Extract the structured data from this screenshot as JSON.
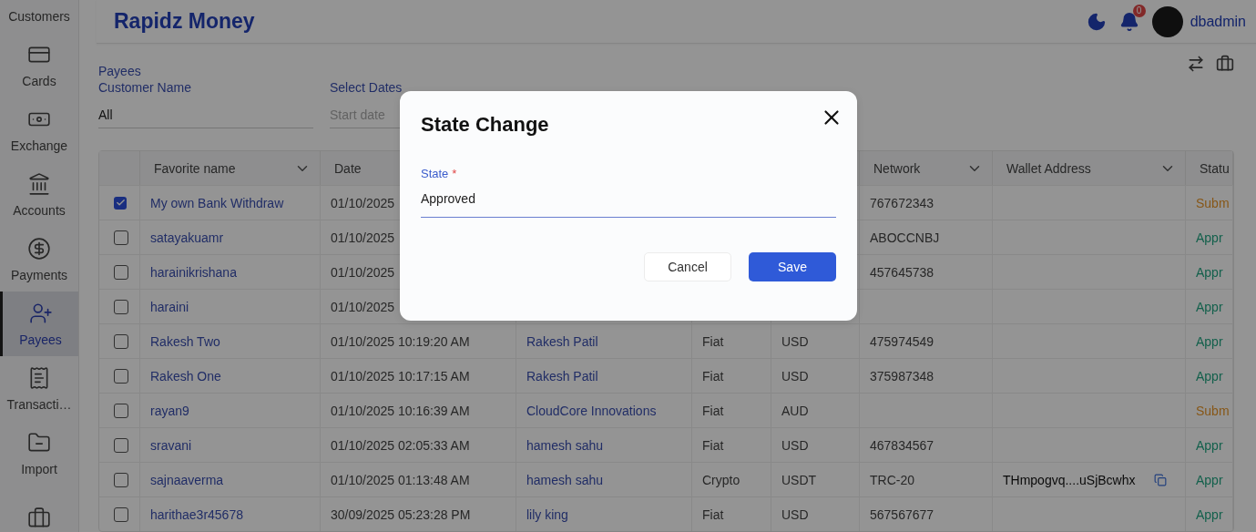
{
  "sidebar": {
    "items": [
      {
        "label": "Customers",
        "kind": "text",
        "selected": false
      },
      {
        "label": "Cards",
        "kind": "card",
        "selected": false
      },
      {
        "label": "Exchange",
        "kind": "banknote",
        "selected": false
      },
      {
        "label": "Accounts",
        "kind": "bank",
        "selected": false
      },
      {
        "label": "Payments",
        "kind": "dollar",
        "selected": false
      },
      {
        "label": "Payees",
        "kind": "user",
        "selected": true
      },
      {
        "label": "Transacti…",
        "kind": "receipt",
        "selected": false
      },
      {
        "label": "Import",
        "kind": "folder",
        "selected": false
      },
      {
        "kind": "briefcase",
        "selected": false
      }
    ]
  },
  "header": {
    "title": "Rapidz Money",
    "notifications": "0",
    "user": "dbadmin"
  },
  "breadcrumb": "Payees",
  "filters": [
    {
      "label": "Customer Name",
      "value": "All"
    },
    {
      "label": "Select Dates",
      "placeholder": "Start date"
    }
  ],
  "table": {
    "columns": [
      {},
      {
        "label": "Favorite name",
        "sortable": true
      },
      {
        "label": "Date"
      },
      {},
      {},
      {},
      {
        "label": "Network",
        "sortable": true
      },
      {
        "label": "Wallet Address",
        "sortable": true
      },
      {
        "label": "Statu"
      }
    ],
    "rows": [
      {
        "checked": true,
        "name": "My own Bank Withdraw",
        "date": "01/10/2025",
        "network": "767672343",
        "status": {
          "text": "Subm",
          "kind": "submitted"
        }
      },
      {
        "checked": false,
        "name": "satayakuamr",
        "date": "01/10/2025",
        "network": "ABOCCNBJ",
        "status": {
          "text": "Appr",
          "kind": "approved"
        }
      },
      {
        "checked": false,
        "name": "harainikrishana",
        "date": "01/10/2025",
        "network": "457645738",
        "status": {
          "text": "Appr",
          "kind": "approved"
        }
      },
      {
        "checked": false,
        "name": "haraini",
        "date": "01/10/2025",
        "status": {
          "text": "Appr",
          "kind": "approved"
        }
      },
      {
        "checked": false,
        "name": "Rakesh Two",
        "date": "01/10/2025 10:19:20 AM",
        "payee": "Rakesh Patil",
        "type": "Fiat",
        "currency": "USD",
        "network": "475974549",
        "status": {
          "text": "Appr",
          "kind": "approved"
        }
      },
      {
        "checked": false,
        "name": "Rakesh One",
        "date": "01/10/2025 10:17:15 AM",
        "payee": "Rakesh Patil",
        "type": "Fiat",
        "currency": "USD",
        "network": "375987348",
        "status": {
          "text": "Appr",
          "kind": "approved"
        }
      },
      {
        "checked": false,
        "name": "rayan9",
        "date": "01/10/2025 10:16:39 AM",
        "payee": "CloudCore Innovations",
        "type": "Fiat",
        "currency": "AUD",
        "status": {
          "text": "Subm",
          "kind": "submitted"
        }
      },
      {
        "checked": false,
        "name": "sravani",
        "date": "01/10/2025 02:05:33 AM",
        "payee": "hamesh sahu",
        "type": "Fiat",
        "currency": "USD",
        "network": "467834567",
        "status": {
          "text": "Appr",
          "kind": "approved"
        }
      },
      {
        "checked": false,
        "name": "sajnaaverma",
        "date": "01/10/2025 01:13:48 AM",
        "payee": "hamesh sahu",
        "type": "Crypto",
        "currency": "USDT",
        "network": "TRC-20",
        "wallet": "THmpogvq....uSjBcwhx",
        "status": {
          "text": "Appr",
          "kind": "approved"
        }
      },
      {
        "checked": false,
        "name": "harithae3r45678",
        "date": "30/09/2025 05:23:28 PM",
        "payee": "lily king",
        "type": "Fiat",
        "currency": "USD",
        "network": "567567677",
        "status": {
          "text": "Appr",
          "kind": "approved"
        }
      }
    ]
  },
  "dialog": {
    "title": "State Change",
    "field": {
      "label": "State",
      "required_mark": "*",
      "value": "Approved"
    },
    "buttons": [
      "Cancel",
      "Save"
    ]
  }
}
